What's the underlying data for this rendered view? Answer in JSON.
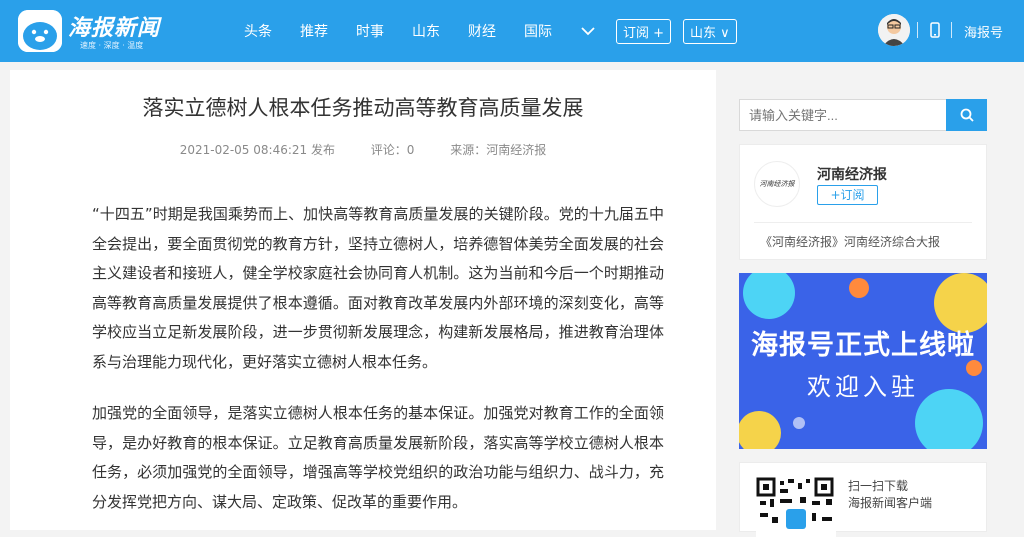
{
  "header": {
    "logo_title": "海报新闻",
    "logo_tagline": "速度 · 深度 · 温度",
    "nav": [
      "头条",
      "推荐",
      "时事",
      "山东",
      "财经",
      "国际"
    ],
    "subscribe_label": "订阅 +",
    "region_label": "山东 ∨",
    "haibao_link": "海报号",
    "bg_color": "#2aa0ea"
  },
  "article": {
    "title": "落实立德树人根本任务推动高等教育高质量发展",
    "published": "2021-02-05 08:46:21 发布",
    "comments": "评论：0",
    "source": "来源：河南经济报",
    "paragraphs": [
      "“十四五”时期是我国乘势而上、加快高等教育高质量发展的关键阶段。党的十九届五中全会提出，要全面贯彻党的教育方针，坚持立德树人，培养德智体美劳全面发展的社会主义建设者和接班人，健全学校家庭社会协同育人机制。这为当前和今后一个时期推动高等教育高质量发展提供了根本遵循。面对教育改革发展内外部环境的深刻变化，高等学校应当立足新发展阶段，进一步贯彻新发展理念，构建新发展格局，推进教育治理体系与治理能力现代化，更好落实立德树人根本任务。",
      "加强党的全面领导，是落实立德树人根本任务的基本保证。加强党对教育工作的全面领导，是办好教育的根本保证。立足教育高质量发展新阶段，落实高等学校立德树人根本任务，必须加强党的全面领导，增强高等学校党组织的政治功能与组织力、战斗力，充分发挥党把方向、谋大局、定政策、促改革的重要作用。"
    ]
  },
  "sidebar": {
    "search_placeholder": "请输入关键字...",
    "source_card": {
      "logo_text": "河南经济报",
      "name": "河南经济报",
      "subscribe_label": "+订阅",
      "description": "《河南经济报》河南经济综合大报"
    },
    "banner": {
      "line1": "海报号正式上线啦",
      "line2": "欢迎入驻"
    },
    "qr": {
      "line1": "扫一扫下载",
      "line2": "海报新闻客户端"
    }
  }
}
